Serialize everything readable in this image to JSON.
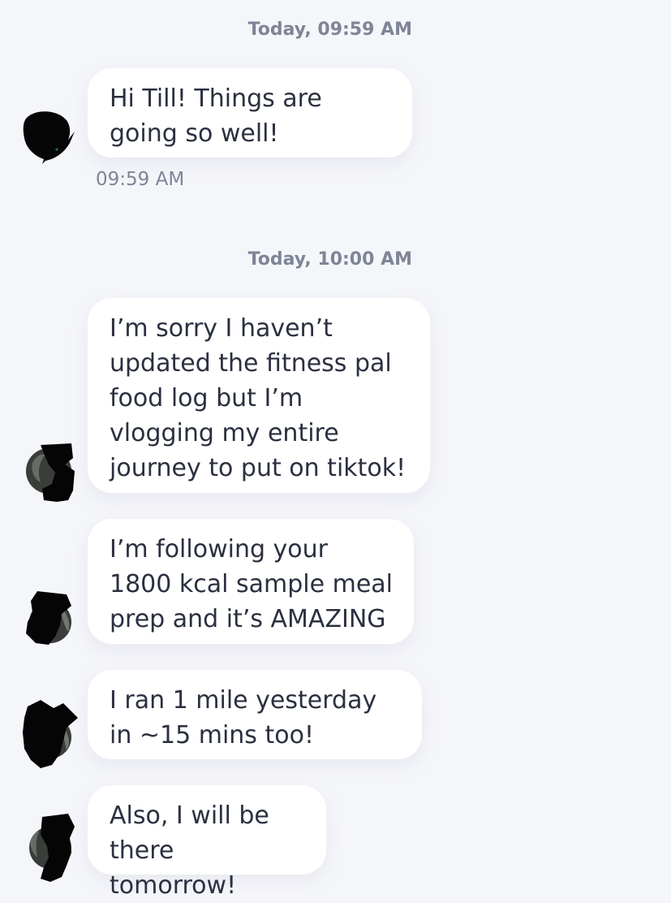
{
  "groups": [
    {
      "date_label": "Today, 09:59 AM",
      "messages": [
        {
          "text": "Hi Till! Things are going so well!",
          "time": "09:59 AM"
        }
      ]
    },
    {
      "date_label": "Today, 10:00 AM",
      "messages": [
        {
          "text": "I’m sorry I haven’t updated the fitness pal food log but I’m vlogging my entire journey to put on tiktok!"
        },
        {
          "text": "I’m following your 1800 kcal sample meal prep and it’s AMAZING"
        },
        {
          "text": "I ran 1 mile yesterday in ~15 mins too!"
        },
        {
          "text": "Also, I will be there tomorrow!"
        }
      ]
    }
  ],
  "colors": {
    "background": "#f5f6fa",
    "bubble": "#ffffff",
    "message_text": "#2b3040",
    "meta_text": "#7f8596"
  }
}
